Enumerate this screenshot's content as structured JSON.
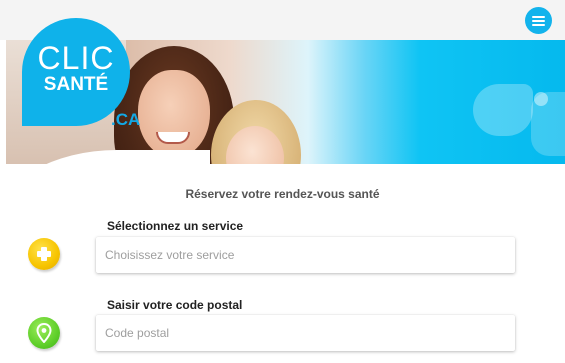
{
  "logo": {
    "line1": "CLIC",
    "line2": "SANTÉ",
    "suffix": ".CA"
  },
  "header": {
    "menu_icon": "hamburger-menu-icon"
  },
  "main": {
    "subtitle": "Réservez votre rendez-vous santé",
    "service": {
      "label": "Sélectionnez un service",
      "placeholder": "Choisissez votre service",
      "value": "",
      "icon": "plus-icon"
    },
    "postal": {
      "label": "Saisir votre code postal",
      "placeholder": "Code postal",
      "value": "",
      "icon": "location-pin-icon"
    }
  },
  "colors": {
    "brand": "#0fb2ea",
    "service_icon": "#f7c400",
    "postal_icon": "#5fcf2a"
  }
}
